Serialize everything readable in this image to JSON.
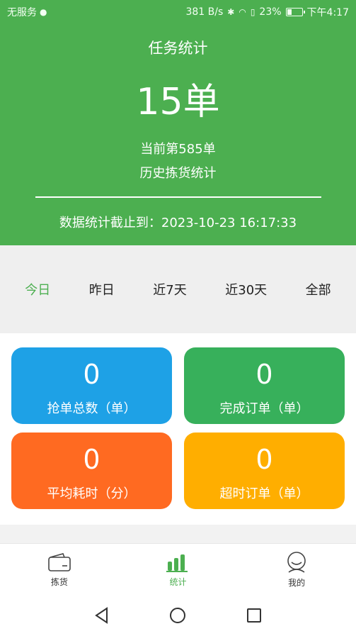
{
  "status_bar": {
    "carrier": "无服务",
    "net_speed": "381 B/s",
    "battery": "23%",
    "time": "下午4:17"
  },
  "header": {
    "title": "任务统计",
    "order_count": "15单",
    "current_order": "当前第585单",
    "history_link": "历史拣货统计",
    "deadline": "数据统计截止到：2023-10-23 16:17:33"
  },
  "tabs": [
    {
      "label": "今日",
      "active": true
    },
    {
      "label": "昨日"
    },
    {
      "label": "近7天"
    },
    {
      "label": "近30天"
    },
    {
      "label": "全部"
    }
  ],
  "cards": [
    {
      "value": "0",
      "label": "抢单总数（单）",
      "color": "#1ea1e6"
    },
    {
      "value": "0",
      "label": "完成订单（单）",
      "color": "#37b05b"
    },
    {
      "value": "0",
      "label": "平均耗时（分）",
      "color": "#ff6a21"
    },
    {
      "value": "0",
      "label": "超时订单（单）",
      "color": "#ffae00"
    }
  ],
  "bottom_nav": [
    {
      "label": "拣货",
      "icon": "wallet-icon"
    },
    {
      "label": "统计",
      "icon": "bar-chart-icon",
      "active": true
    },
    {
      "label": "我的",
      "icon": "profile-face-icon"
    }
  ],
  "system_nav": {
    "back_icon": "back-triangle-icon",
    "home_icon": "home-circle-icon",
    "recents_icon": "recents-square-icon"
  },
  "colors": {
    "accent": "#4caf50",
    "tab_bg": "#efefef"
  }
}
